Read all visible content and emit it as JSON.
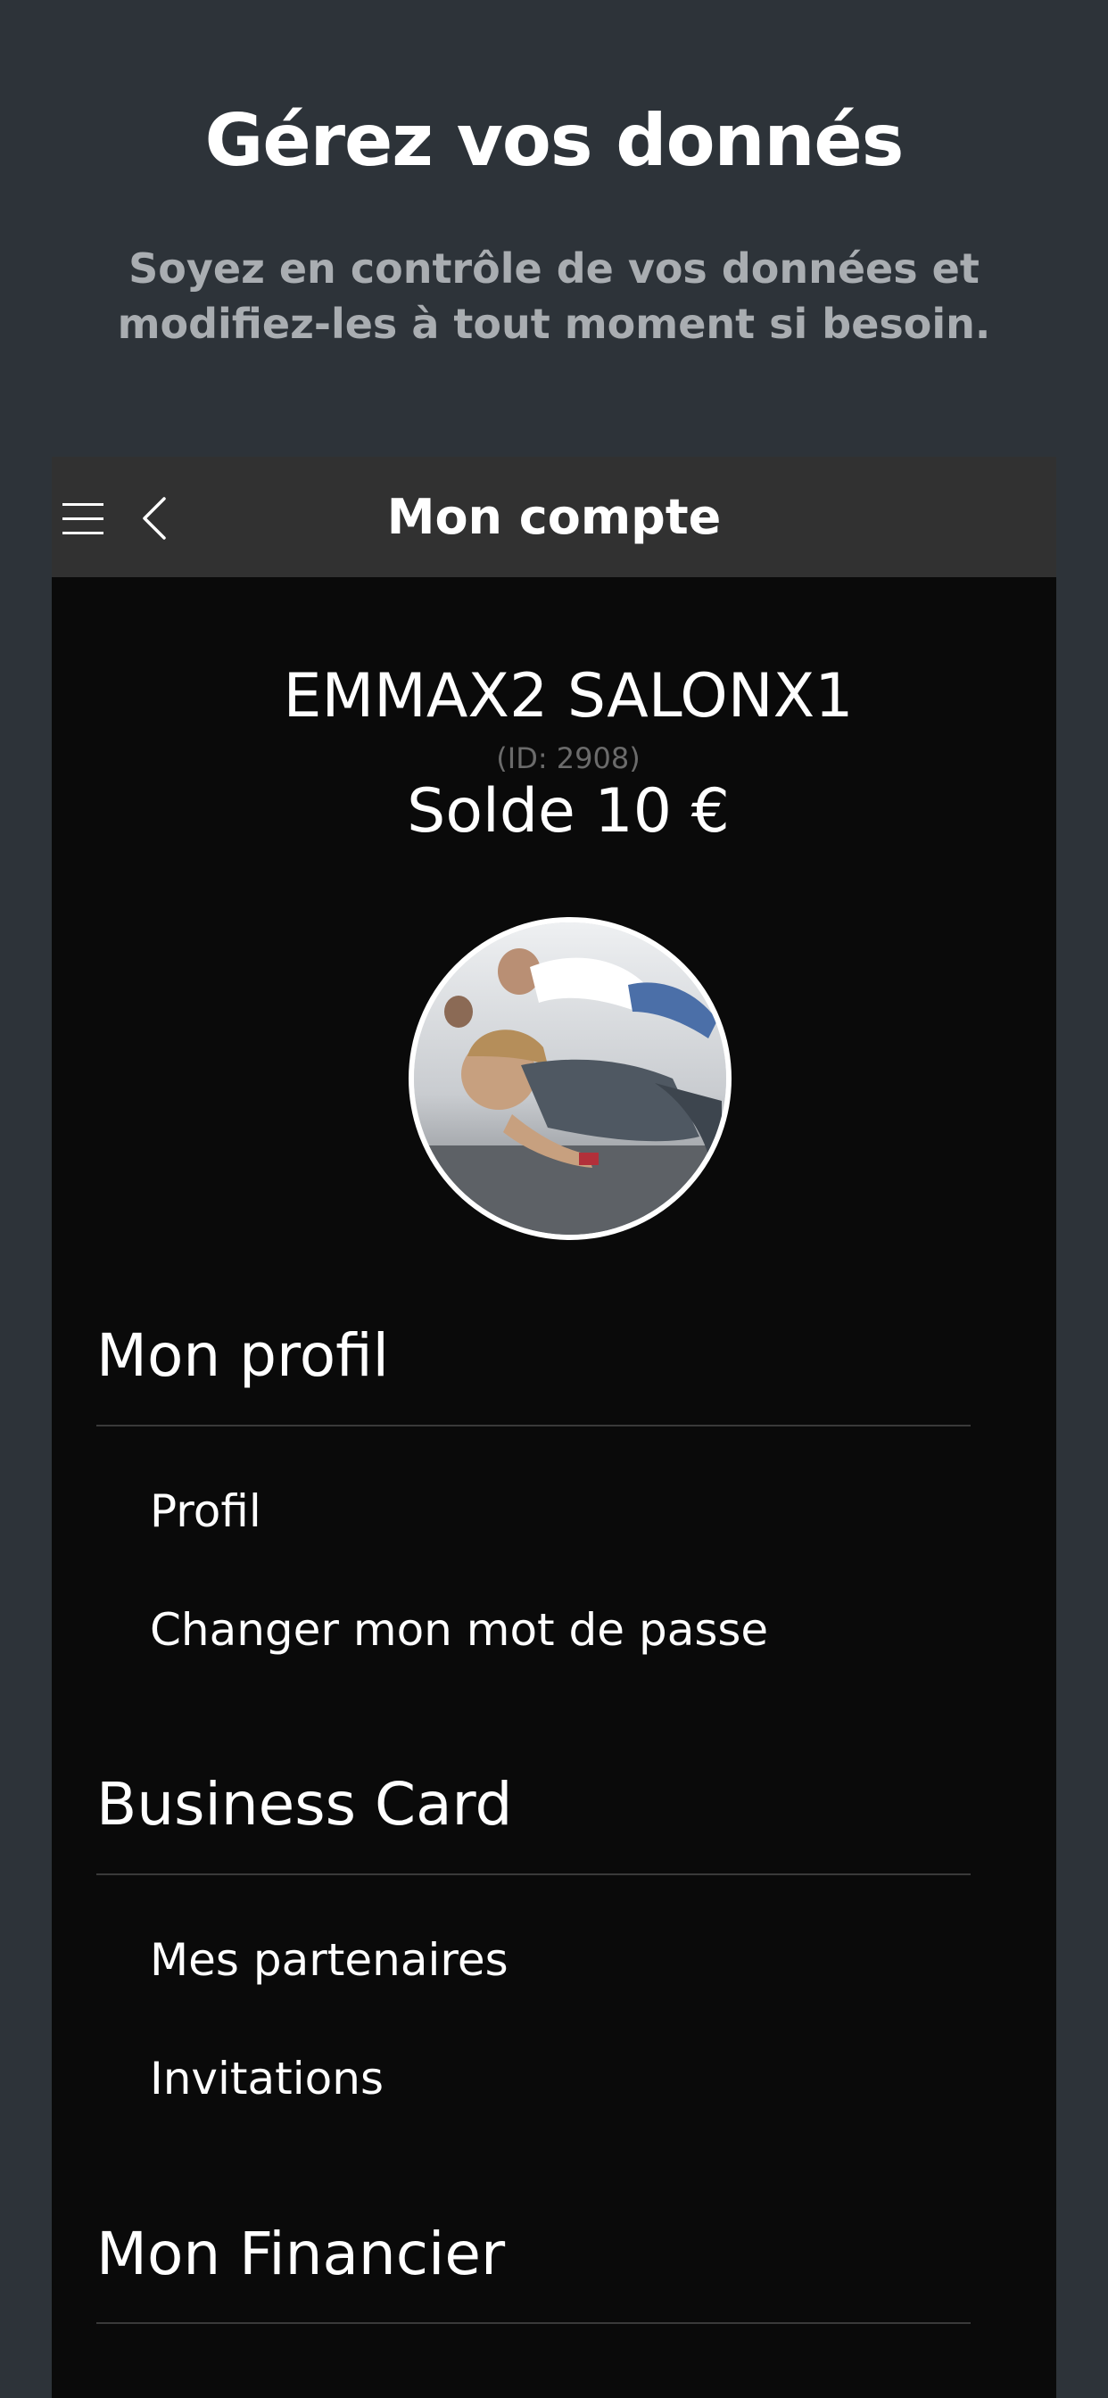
{
  "promo": {
    "title": "Gérez vos donnés",
    "subtitle": "Soyez en contrôle de vos données et modifiez-les à tout moment si besoin."
  },
  "appbar": {
    "title": "Mon compte",
    "menu_icon": "hamburger-menu-icon",
    "back_icon": "chevron-left-icon"
  },
  "user": {
    "name": "EMMAX2 SALONX1",
    "id": "(ID: 2908)",
    "balance": "Solde 10 €"
  },
  "sections": [
    {
      "title": "Mon profil",
      "items": [
        "Profil",
        "Changer mon mot de passe"
      ]
    },
    {
      "title": "Business Card",
      "items": [
        "Mes partenaires",
        "Invitations"
      ]
    },
    {
      "title": "Mon Financier",
      "items": []
    }
  ],
  "colors": {
    "page_background": "#2d3339",
    "app_background": "#0a0a0a",
    "appbar_background": "#313131",
    "subtitle_text": "#a9adb1"
  }
}
